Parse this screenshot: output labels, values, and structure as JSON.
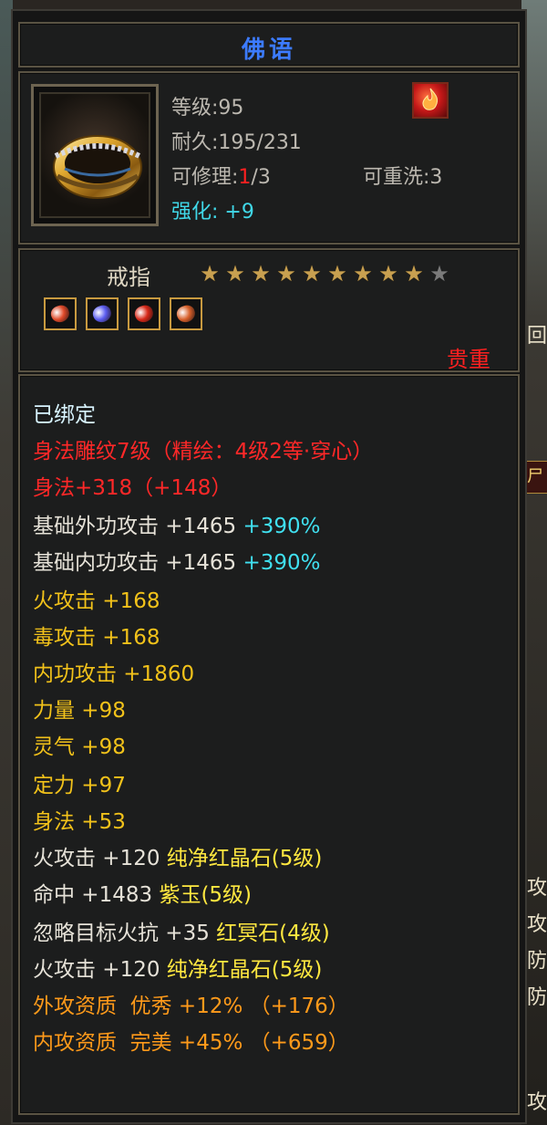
{
  "tooltip": {
    "item_name": "佛语",
    "level": "等级:95",
    "durability": "耐久:195/231",
    "repair_label": "可修理:",
    "repair_current": "1",
    "repair_max": "/3",
    "rewash": "可重洗:3",
    "enhance_label": "强化:",
    "enhance_value": "+9",
    "item_type": "戒指",
    "stars_filled": 9,
    "stars_total": 10,
    "quality": "贵重",
    "gems": [
      {
        "name": "green-red-gem-icon",
        "color": "#e04a2a"
      },
      {
        "name": "blue-gem-icon",
        "color": "#5a5cf0"
      },
      {
        "name": "red-gem-icon",
        "color": "#d82818"
      },
      {
        "name": "green-red-gem-icon-2",
        "color": "#d8602a"
      }
    ]
  },
  "attributes": {
    "bound": "已绑定",
    "engrave": "身法雕纹7级（精绘：4级2等·穿心）",
    "agility_bonus": "身法+318（+148）",
    "ext_atk_label": "基础外功攻击 +1465",
    "ext_atk_pct": "+390%",
    "int_atk_label": "基础内功攻击 +1465",
    "int_atk_pct": "+390%",
    "fire_atk": "火攻击 +168",
    "poison_atk": "毒攻击 +168",
    "internal_atk": "内功攻击 +1860",
    "strength": "力量 +98",
    "spirit": "灵气 +98",
    "focus": "定力 +97",
    "agility": "身法 +53",
    "gem1_stat": "火攻击 +120 ",
    "gem1_name": "纯净红晶石(5级)",
    "gem2_stat": "命中 +1483 ",
    "gem2_name": "紫玉(5级)",
    "gem3_stat": "忽略目标火抗 +35 ",
    "gem3_name": "红冥石(4级)",
    "gem4_stat": "火攻击 +120 ",
    "gem4_name": "纯净红晶石(5级)",
    "ext_aptitude": "外攻资质  优秀 +12% （+176）",
    "int_aptitude": "内攻资质  完美 +45% （+659）"
  },
  "background": {
    "right_chars": [
      "回",
      "攻",
      "攻",
      "防",
      "防",
      "攻"
    ],
    "right_tag": "尸"
  },
  "colors": {
    "title_blue": "#3c7bff",
    "red": "#ff2828",
    "cyan": "#40e0f0",
    "gold": "#f2c21a",
    "orange": "#ff9a1a"
  }
}
